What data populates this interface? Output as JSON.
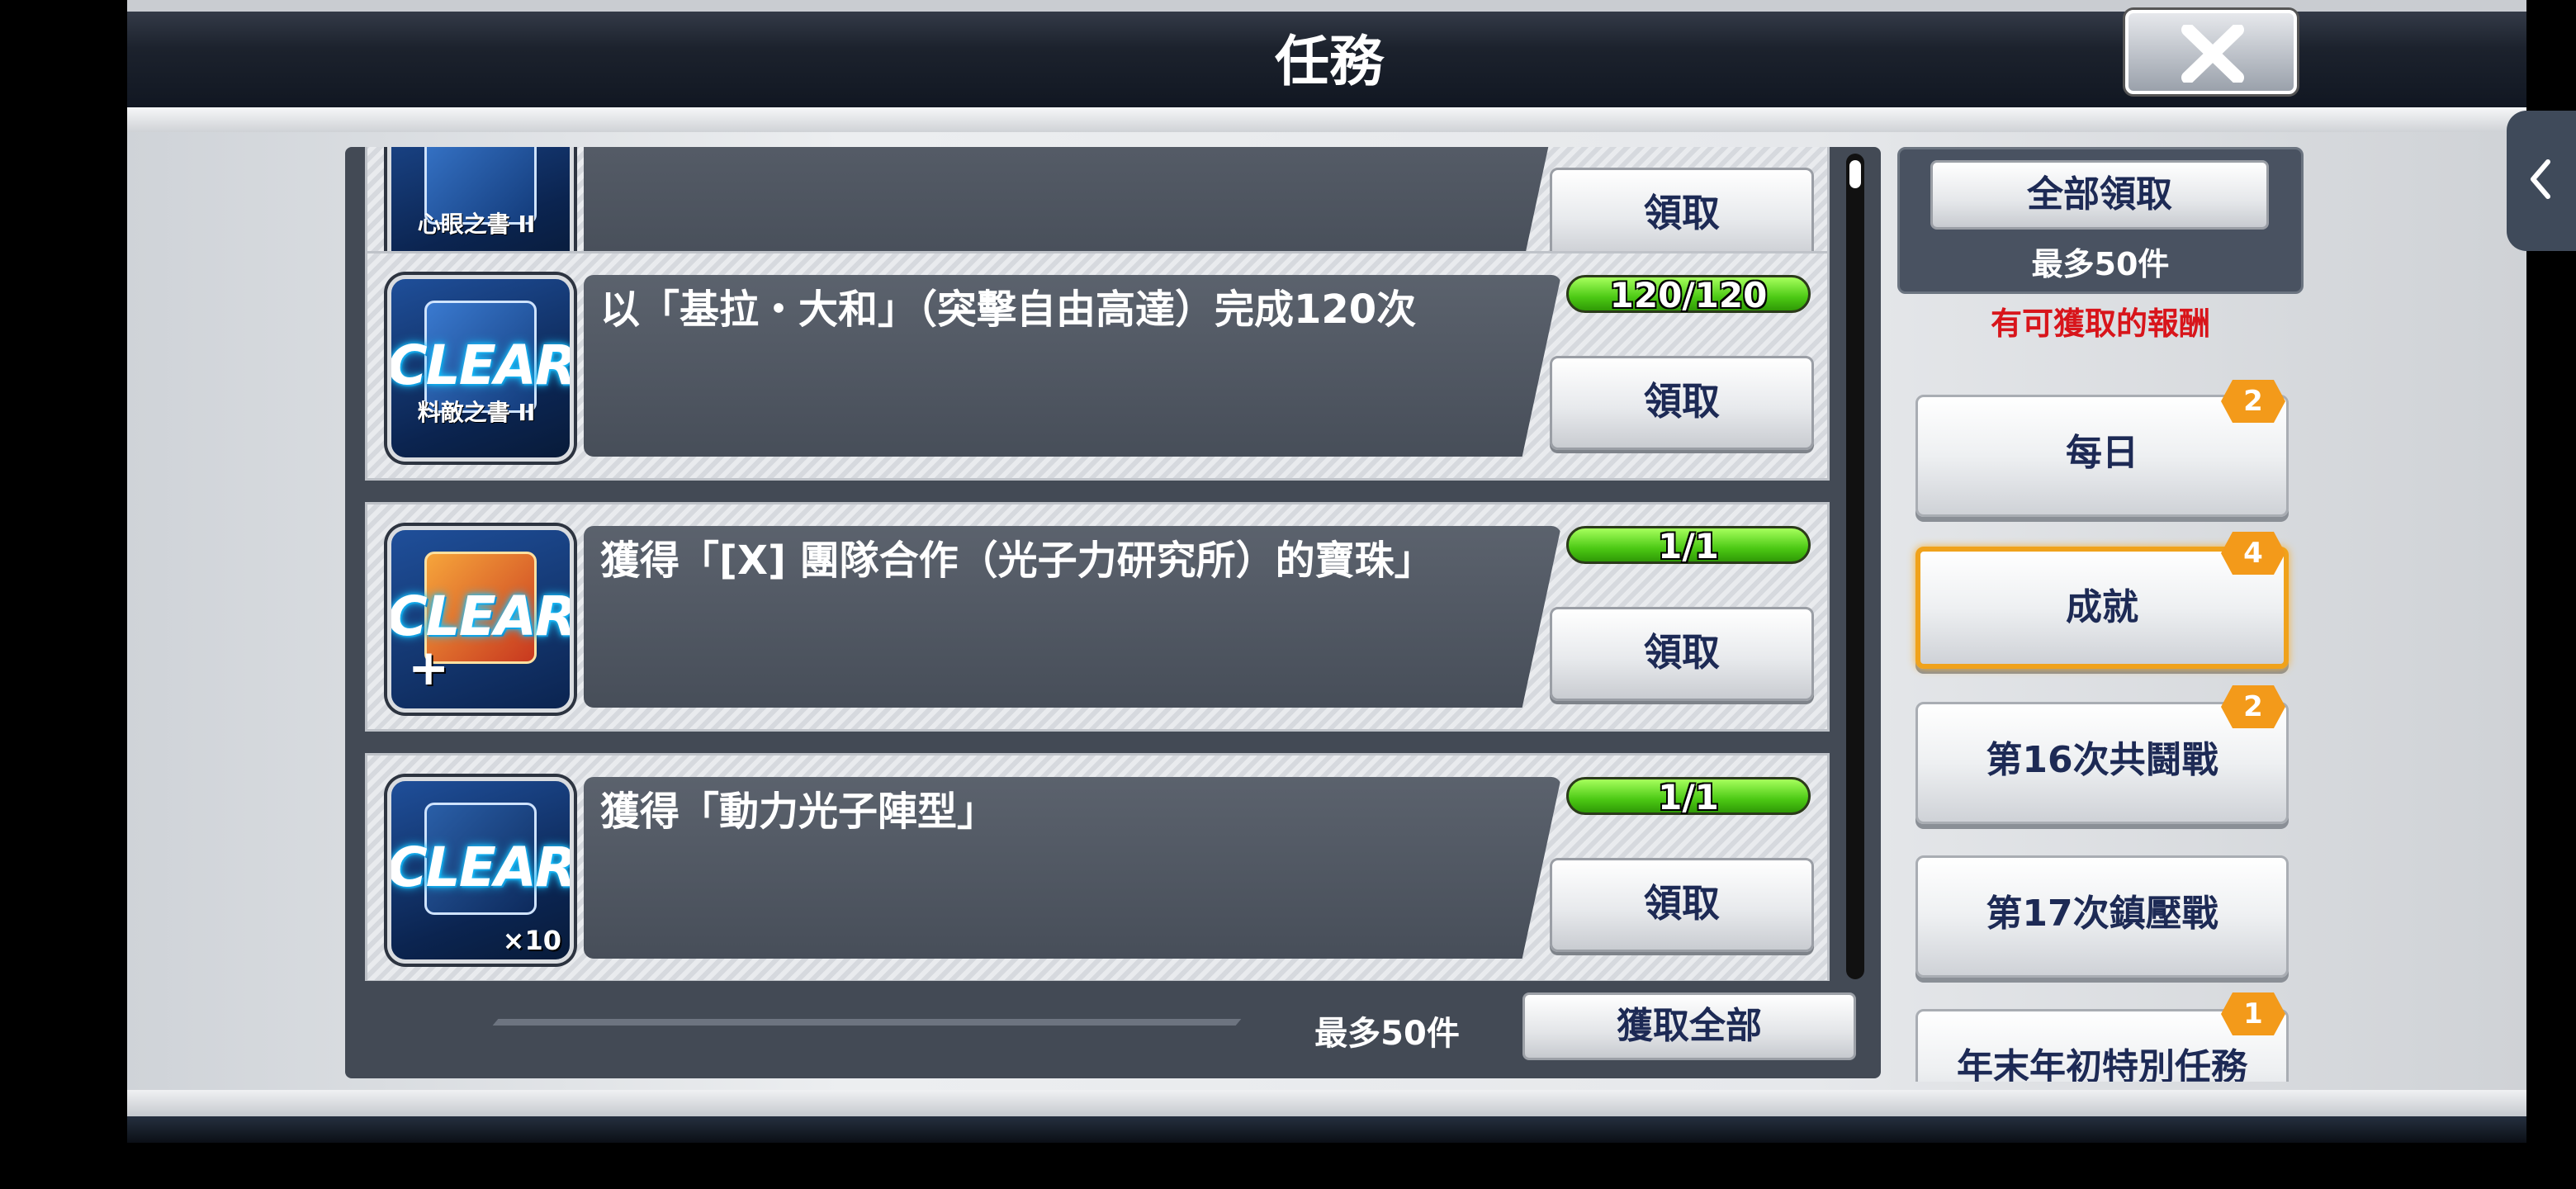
{
  "header": {
    "title": "任務",
    "close_icon": "close-icon"
  },
  "missions": [
    {
      "icon_sub": "心眼之書 II",
      "description": "",
      "progress": "",
      "claim_label": "領取",
      "partial": true
    },
    {
      "icon_sub": "料敵之書 II",
      "icon_badge": "CLEAR",
      "description": "以「基拉・大和」（突擊自由高達）完成120次",
      "progress": "120/120",
      "claim_label": "領取"
    },
    {
      "icon_sub": "",
      "icon_badge": "CLEAR",
      "description": "獲得「[X] 團隊合作（光子力研究所）的寶珠」",
      "progress": "1/1",
      "claim_label": "領取"
    },
    {
      "icon_sub": "",
      "icon_badge": "CLEAR",
      "icon_qty": "×10",
      "description": "獲得「動力光子陣型」",
      "progress": "1/1",
      "claim_label": "領取"
    }
  ],
  "list_footer": {
    "max_label": "最多50件",
    "get_all_label": "獲取全部"
  },
  "sidebar": {
    "claim_all_label": "全部領取",
    "claim_all_max": "最多50件",
    "reward_note": "有可獲取的報酬",
    "tabs": [
      {
        "label": "每日",
        "badge": "2"
      },
      {
        "label": "成就",
        "badge": "4",
        "active": true
      },
      {
        "label": "第16次共鬪戰",
        "badge": "2"
      },
      {
        "label": "第17次鎮壓戰",
        "badge": ""
      },
      {
        "label": "年末年初特別任務",
        "badge": "1"
      }
    ]
  },
  "colors": {
    "accent_badge": "#f39a1a",
    "progress_green": "#4cc914",
    "reward_note_red": "#d8151b",
    "active_tab_border": "#f0a21b"
  }
}
